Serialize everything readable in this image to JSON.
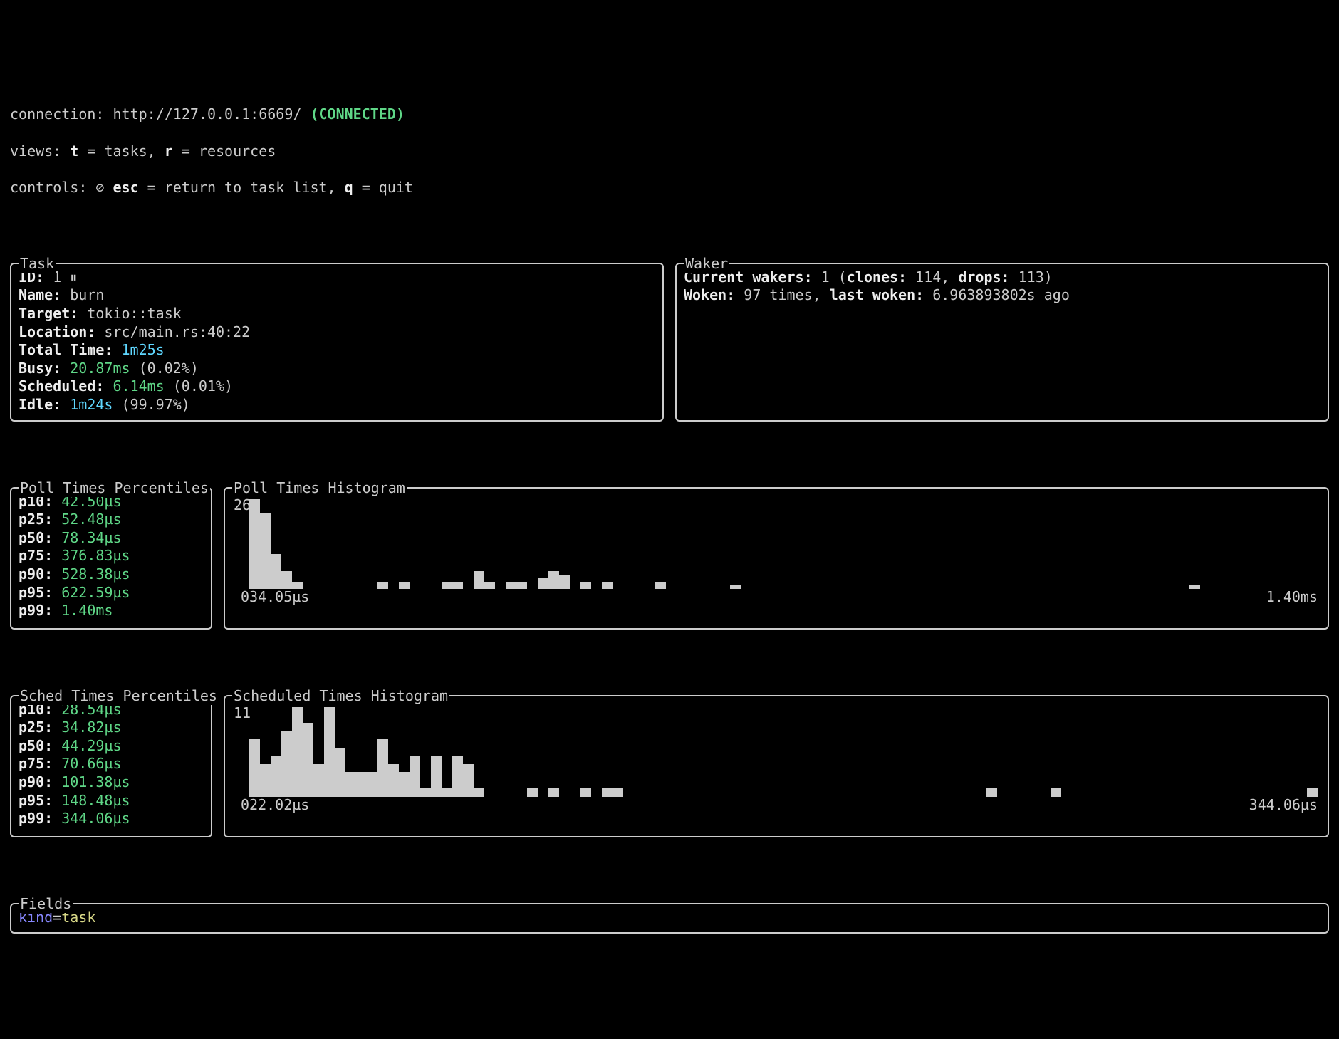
{
  "header": {
    "connection_label": "connection: ",
    "connection_url": "http://127.0.0.1:6669/ ",
    "connected": "(CONNECTED)",
    "views_label": "views: ",
    "views_t_key": "t",
    "views_t_desc": " = tasks, ",
    "views_r_key": "r",
    "views_r_desc": " = resources",
    "controls_label": "controls: ",
    "controls_icon": "⊘ ",
    "controls_esc": "esc",
    "controls_esc_desc": " = return to task list, ",
    "controls_q": "q",
    "controls_q_desc": " = quit"
  },
  "task": {
    "title": "Task",
    "id_label": "ID: ",
    "id_value": "1 ",
    "pause_icon": "⏸",
    "name_label": "Name: ",
    "name_value": "burn",
    "target_label": "Target: ",
    "target_value": "tokio::task",
    "location_label": "Location: ",
    "location_value": "src/main.rs:40:22",
    "total_label": "Total Time: ",
    "total_value": "1m25s",
    "busy_label": "Busy: ",
    "busy_value": "20.87ms",
    "busy_pct": " (0.02%)",
    "sched_label": "Scheduled: ",
    "sched_value": "6.14ms",
    "sched_pct": " (0.01%)",
    "idle_label": "Idle: ",
    "idle_value": "1m24s",
    "idle_pct": " (99.97%)"
  },
  "waker": {
    "title": "Waker",
    "current_label": "Current wakers: ",
    "current_value": "1 (",
    "clones_label": "clones: ",
    "clones_value": "114, ",
    "drops_label": "drops: ",
    "drops_value": "113)",
    "woken_label": "Woken: ",
    "woken_value": "97 times, ",
    "last_label": "last woken: ",
    "last_value": "6.963893802s ago"
  },
  "poll_perc": {
    "title": "Poll Times Percentiles",
    "rows": [
      {
        "label": "p10: ",
        "value": "42.50µs"
      },
      {
        "label": "p25: ",
        "value": "52.48µs"
      },
      {
        "label": "p50: ",
        "value": "78.34µs"
      },
      {
        "label": "p75: ",
        "value": "376.83µs"
      },
      {
        "label": "p90: ",
        "value": "528.38µs"
      },
      {
        "label": "p95: ",
        "value": "622.59µs"
      },
      {
        "label": "p99: ",
        "value": "1.40ms"
      }
    ]
  },
  "poll_hist": {
    "title": "Poll Times Histogram",
    "ymax": "26",
    "ymin_glyph": "0",
    "xmin": "34.05µs",
    "xmax": "1.40ms"
  },
  "sched_perc": {
    "title": "Sched Times Percentiles",
    "rows": [
      {
        "label": "p10: ",
        "value": "28.54µs"
      },
      {
        "label": "p25: ",
        "value": "34.82µs"
      },
      {
        "label": "p50: ",
        "value": "44.29µs"
      },
      {
        "label": "p75: ",
        "value": "70.66µs"
      },
      {
        "label": "p90: ",
        "value": "101.38µs"
      },
      {
        "label": "p95: ",
        "value": "148.48µs"
      },
      {
        "label": "p99: ",
        "value": "344.06µs"
      }
    ]
  },
  "sched_hist": {
    "title": "Scheduled Times Histogram",
    "ymax": "11",
    "ymin_glyph": "0",
    "xmin": "22.02µs",
    "xmax": "344.06µs"
  },
  "fields": {
    "title": "Fields",
    "key": "kind",
    "eq": "=",
    "value": "task"
  },
  "chart_data": [
    {
      "type": "bar",
      "title": "Poll Times Histogram",
      "xlabel": "",
      "ylabel": "",
      "xmin": "34.05µs",
      "xmax": "1.40ms",
      "ylim": [
        0,
        26
      ],
      "values": [
        26,
        22,
        10,
        5,
        2,
        0,
        0,
        0,
        0,
        0,
        0,
        0,
        2,
        0,
        2,
        0,
        0,
        0,
        2,
        2,
        0,
        5,
        2,
        0,
        2,
        2,
        0,
        3,
        5,
        4,
        0,
        2,
        0,
        2,
        0,
        0,
        0,
        0,
        2,
        0,
        0,
        0,
        0,
        0,
        0,
        1,
        0,
        0,
        0,
        0,
        0,
        0,
        0,
        0,
        0,
        0,
        0,
        0,
        0,
        0,
        0,
        0,
        0,
        0,
        0,
        0,
        0,
        0,
        0,
        0,
        0,
        0,
        0,
        0,
        0,
        0,
        0,
        0,
        0,
        0,
        0,
        0,
        0,
        0,
        0,
        0,
        0,
        0,
        1,
        0,
        0,
        0,
        0,
        0,
        0,
        0,
        0,
        0,
        0,
        0
      ]
    },
    {
      "type": "bar",
      "title": "Scheduled Times Histogram",
      "xlabel": "",
      "ylabel": "",
      "xmin": "22.02µs",
      "xmax": "344.06µs",
      "ylim": [
        0,
        11
      ],
      "values": [
        7,
        4,
        5,
        8,
        11,
        9,
        4,
        11,
        6,
        3,
        3,
        3,
        7,
        4,
        3,
        5,
        1,
        5,
        1,
        5,
        4,
        1,
        0,
        0,
        0,
        0,
        1,
        0,
        1,
        0,
        0,
        1,
        0,
        1,
        1,
        0,
        0,
        0,
        0,
        0,
        0,
        0,
        0,
        0,
        0,
        0,
        0,
        0,
        0,
        0,
        0,
        0,
        0,
        0,
        0,
        0,
        0,
        0,
        0,
        0,
        0,
        0,
        0,
        0,
        0,
        0,
        0,
        0,
        0,
        1,
        0,
        0,
        0,
        0,
        0,
        1,
        0,
        0,
        0,
        0,
        0,
        0,
        0,
        0,
        0,
        0,
        0,
        0,
        0,
        0,
        0,
        0,
        0,
        0,
        0,
        0,
        0,
        0,
        0,
        1
      ]
    }
  ]
}
